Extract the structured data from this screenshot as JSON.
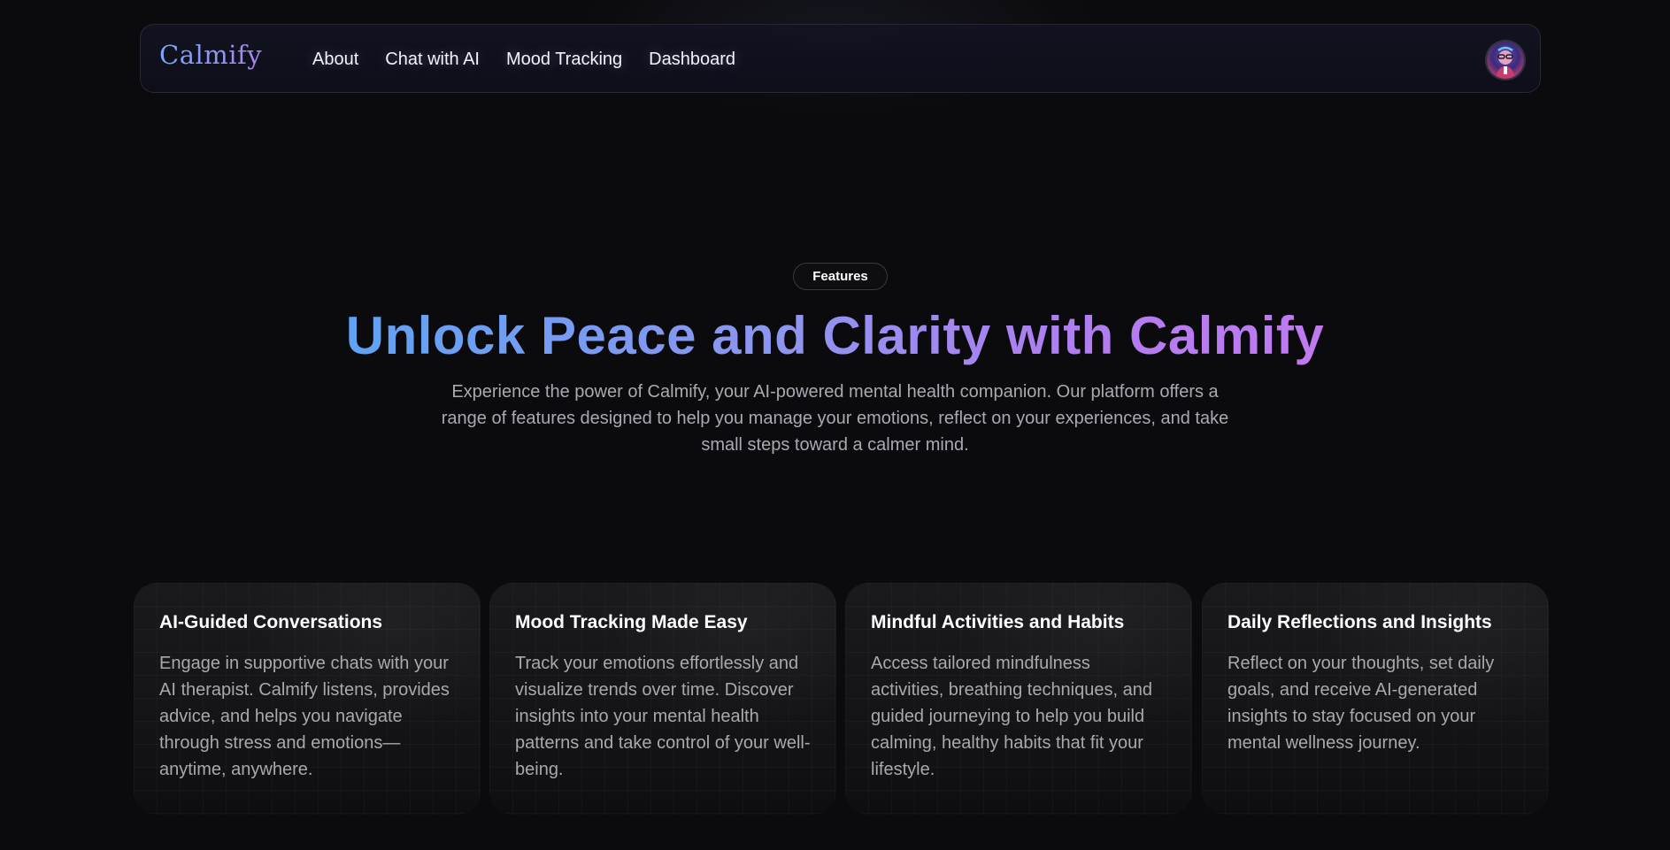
{
  "navbar": {
    "logo": "Calmify",
    "links": [
      {
        "label": "About"
      },
      {
        "label": "Chat with AI"
      },
      {
        "label": "Mood Tracking"
      },
      {
        "label": "Dashboard"
      }
    ],
    "avatar_icon": "user-avatar"
  },
  "hero": {
    "badge": "Features",
    "title": "Unlock Peace and Clarity with Calmify",
    "description": "Experience the power of Calmify, your AI-powered mental health companion. Our platform offers a range of features designed to help you manage your emotions, reflect on your experiences, and take small steps toward a calmer mind."
  },
  "features": [
    {
      "title": "AI-Guided Conversations",
      "text": "Engage in supportive chats with your AI therapist. Calmify listens, provides advice, and helps you navigate through stress and emotions—anytime, anywhere."
    },
    {
      "title": "Mood Tracking Made Easy",
      "text": "Track your emotions effortlessly and visualize trends over time. Discover insights into your mental health patterns and take control of your well-being."
    },
    {
      "title": "Mindful Activities and Habits",
      "text": "Access tailored mindfulness activities, breathing techniques, and guided journeying to help you build calming, healthy habits that fit your lifestyle."
    },
    {
      "title": "Daily Reflections and Insights",
      "text": "Reflect on your thoughts, set daily goals, and receive AI-generated insights to stay focused on your mental wellness journey."
    }
  ],
  "colors": {
    "background": "#0b0b0e",
    "gradient_start": "#5fa2f4",
    "gradient_end": "#c07af0",
    "muted_text": "#a9a9b3"
  }
}
